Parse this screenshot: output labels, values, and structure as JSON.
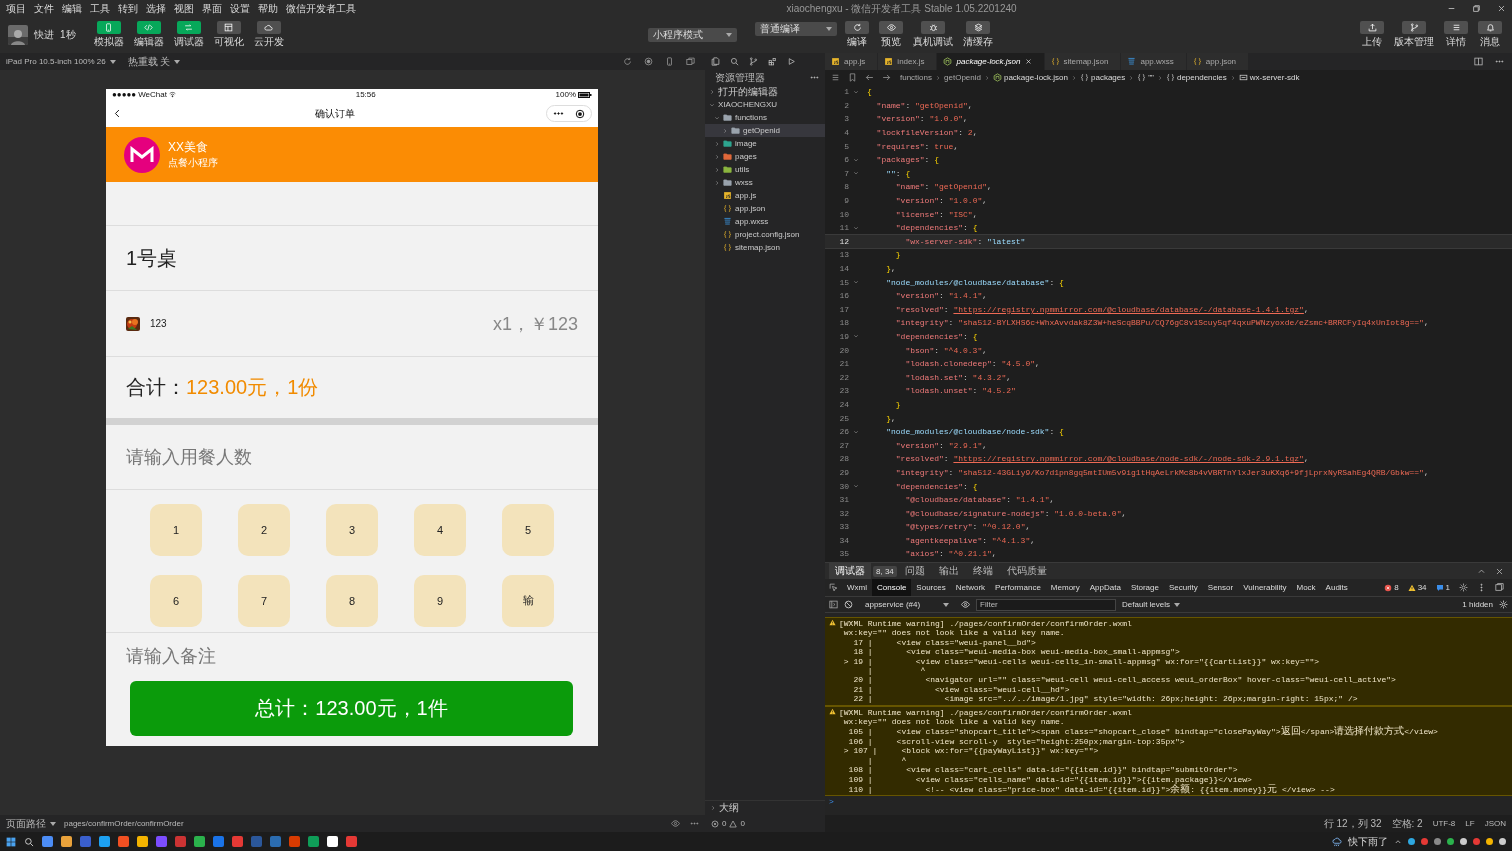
{
  "menu_bar": {
    "items": [
      "项目",
      "文件",
      "编辑",
      "工具",
      "转到",
      "选择",
      "视图",
      "界面",
      "设置",
      "帮助",
      "微信开发者工具"
    ],
    "title": "xiaochengxu - 微信开发者工具 Stable 1.05.2201240"
  },
  "toolbar": {
    "user_name": "快进",
    "timer": "1秒",
    "view_toggles": [
      {
        "label": "模拟器",
        "kind": "phone",
        "on": true
      },
      {
        "label": "编辑器",
        "kind": "code",
        "on": true
      },
      {
        "label": "调试器",
        "kind": "debug",
        "on": true
      },
      {
        "label": "可视化",
        "kind": "layout",
        "on": false
      },
      {
        "label": "云开发",
        "kind": "cloud",
        "on": false
      }
    ],
    "mode_select": "小程序模式",
    "compile_select": "普通编译",
    "actions": [
      {
        "label": "编译",
        "kind": "refresh"
      },
      {
        "label": "预览",
        "kind": "eye"
      },
      {
        "label": "真机调试",
        "kind": "bug"
      },
      {
        "label": "清缓存",
        "kind": "layers"
      }
    ],
    "right_actions": [
      {
        "label": "上传",
        "kind": "upload"
      },
      {
        "label": "版本管理",
        "kind": "branch"
      },
      {
        "label": "详情",
        "kind": "list"
      },
      {
        "label": "消息",
        "kind": "bell"
      }
    ]
  },
  "simulator": {
    "device": "iPad Pro 10.5-inch 100% 26",
    "hot_reload": "热重载 关",
    "page_path_label": "页面路径",
    "page_path": "pages/confirmOrder/confirmOrder",
    "phone": {
      "signal": "●●●●●",
      "carrier": "WeChat",
      "time": "15:56",
      "battery": "100%",
      "nav_title": "确认订单",
      "shop_name": "XX美食",
      "shop_subtitle": "点餐小程序",
      "table": "1号桌",
      "items": [
        {
          "name": "123",
          "qty_price": "x1，￥123"
        }
      ],
      "total_label": "合计：",
      "total_value": "123.00元，1份",
      "people_placeholder": "请输入用餐人数",
      "keypad": [
        "1",
        "2",
        "3",
        "4",
        "5",
        "6",
        "7",
        "8",
        "9",
        "输"
      ],
      "note_placeholder": "请输入备注",
      "submit": "总计：123.00元，1件"
    }
  },
  "explorer": {
    "title": "资源管理器",
    "sections": [
      {
        "label": "打开的编辑器",
        "expanded": false
      },
      {
        "label": "XIAOCHENGXU",
        "expanded": true
      }
    ],
    "tree": [
      {
        "name": "functions",
        "kind": "folder",
        "expanded": true,
        "selected": false,
        "children": [
          {
            "name": "getOpenid",
            "kind": "folder",
            "expanded": false,
            "selected": true
          }
        ]
      },
      {
        "name": "image",
        "kind": "folder-image",
        "expanded": false,
        "selected": false
      },
      {
        "name": "pages",
        "kind": "folder-pages",
        "expanded": false,
        "selected": false
      },
      {
        "name": "utils",
        "kind": "folder-utils",
        "expanded": false,
        "selected": false
      },
      {
        "name": "wxss",
        "kind": "folder",
        "expanded": false,
        "selected": false
      },
      {
        "name": "app.js",
        "kind": "js",
        "selected": false
      },
      {
        "name": "app.json",
        "kind": "json",
        "selected": false
      },
      {
        "name": "app.wxss",
        "kind": "css",
        "selected": false
      },
      {
        "name": "project.config.json",
        "kind": "json",
        "selected": false
      },
      {
        "name": "sitemap.json",
        "kind": "json",
        "selected": false
      }
    ],
    "outline": "大纲",
    "errors": "0",
    "warnings": "0"
  },
  "editor": {
    "tabs": [
      {
        "name": "app.js",
        "kind": "js",
        "selected": false
      },
      {
        "name": "index.js",
        "kind": "js",
        "selected": false
      },
      {
        "name": "package-lock.json",
        "kind": "npm",
        "selected": true
      },
      {
        "name": "sitemap.json",
        "kind": "json",
        "selected": false
      },
      {
        "name": "app.wxss",
        "kind": "css",
        "selected": false
      },
      {
        "name": "app.json",
        "kind": "json",
        "selected": false
      }
    ],
    "breadcrumb": [
      {
        "text": "functions",
        "kind": "plain"
      },
      {
        "text": "getOpenid",
        "kind": "plain"
      },
      {
        "text": "package-lock.json",
        "kind": "npm"
      },
      {
        "text": "packages",
        "kind": "object"
      },
      {
        "text": "\"\"",
        "kind": "object"
      },
      {
        "text": "dependencies",
        "kind": "object"
      },
      {
        "text": "wx-server-sdk",
        "kind": "property"
      }
    ],
    "lines": [
      {
        "num": "1",
        "fold": true,
        "current": false,
        "t": [
          {
            "kind": "brace",
            "text": "{"
          }
        ],
        "children": [
          {
            "num": "2",
            "fold": false,
            "current": false,
            "t": [
              {
                "kind": "key",
                "text": "\"name\""
              },
              {
                "kind": "punct",
                "text": ": "
              },
              {
                "kind": "str",
                "text": "\"getOpenid\""
              },
              {
                "kind": "punct",
                "text": ","
              }
            ]
          },
          {
            "num": "3",
            "fold": false,
            "current": false,
            "t": [
              {
                "kind": "key",
                "text": "\"version\""
              },
              {
                "kind": "punct",
                "text": ": "
              },
              {
                "kind": "str",
                "text": "\"1.0.0\""
              },
              {
                "kind": "punct",
                "text": ","
              }
            ]
          },
          {
            "num": "4",
            "fold": false,
            "current": false,
            "t": [
              {
                "kind": "key",
                "text": "\"lockfileVersion\""
              },
              {
                "kind": "punct",
                "text": ": "
              },
              {
                "kind": "str",
                "text": "2"
              },
              {
                "kind": "punct",
                "text": ","
              }
            ]
          },
          {
            "num": "5",
            "fold": false,
            "current": false,
            "t": [
              {
                "kind": "key",
                "text": "\"requires\""
              },
              {
                "kind": "punct",
                "text": ": "
              },
              {
                "kind": "str",
                "text": "true"
              },
              {
                "kind": "punct",
                "text": ","
              }
            ]
          },
          {
            "num": "6",
            "fold": true,
            "current": false,
            "t": [
              {
                "kind": "key",
                "text": "\"packages\""
              },
              {
                "kind": "punct",
                "text": ": "
              },
              {
                "kind": "brace",
                "text": "{"
              }
            ],
            "children": [
              {
                "num": "7",
                "fold": true,
                "current": false,
                "t": [
                  {
                    "kind": "key2",
                    "text": "\"\""
                  },
                  {
                    "kind": "punct",
                    "text": ": "
                  },
                  {
                    "kind": "brace",
                    "text": "{"
                  }
                ],
                "children": [
                  {
                    "num": "8",
                    "fold": false,
                    "current": false,
                    "t": [
                      {
                        "kind": "key",
                        "text": "\"name\""
                      },
                      {
                        "kind": "punct",
                        "text": ": "
                      },
                      {
                        "kind": "str",
                        "text": "\"getOpenid\""
                      },
                      {
                        "kind": "punct",
                        "text": ","
                      }
                    ]
                  },
                  {
                    "num": "9",
                    "fold": false,
                    "current": false,
                    "t": [
                      {
                        "kind": "key",
                        "text": "\"version\""
                      },
                      {
                        "kind": "punct",
                        "text": ": "
                      },
                      {
                        "kind": "str",
                        "text": "\"1.0.0\""
                      },
                      {
                        "kind": "punct",
                        "text": ","
                      }
                    ]
                  },
                  {
                    "num": "10",
                    "fold": false,
                    "current": false,
                    "t": [
                      {
                        "kind": "key",
                        "text": "\"license\""
                      },
                      {
                        "kind": "punct",
                        "text": ": "
                      },
                      {
                        "kind": "str",
                        "text": "\"ISC\""
                      },
                      {
                        "kind": "punct",
                        "text": ","
                      }
                    ]
                  },
                  {
                    "num": "11",
                    "fold": true,
                    "current": false,
                    "t": [
                      {
                        "kind": "key",
                        "text": "\"dependencies\""
                      },
                      {
                        "kind": "punct",
                        "text": ": "
                      },
                      {
                        "kind": "brace",
                        "text": "{"
                      }
                    ],
                    "children": [
                      {
                        "num": "12",
                        "fold": false,
                        "current": true,
                        "t": [
                          {
                            "kind": "key",
                            "text": "\"wx-server-sdk\""
                          },
                          {
                            "kind": "punct",
                            "text": ": "
                          },
                          {
                            "kind": "val",
                            "text": "\"latest\""
                          }
                        ]
                      }
                    ]
                  },
                  {
                    "num": "13",
                    "fold": false,
                    "current": false,
                    "t": [
                      {
                        "kind": "brace",
                        "text": "}"
                      }
                    ]
                  }
                ]
              },
              {
                "num": "14",
                "fold": false,
                "current": false,
                "t": [
                  {
                    "kind": "brace",
                    "text": "}"
                  },
                  {
                    "kind": "punct",
                    "text": ","
                  }
                ]
              },
              {
                "num": "15",
                "fold": true,
                "current": false,
                "t": [
                  {
                    "kind": "key2",
                    "text": "\"node_modules/@cloudbase/database\""
                  },
                  {
                    "kind": "punct",
                    "text": ": "
                  },
                  {
                    "kind": "brace",
                    "text": "{"
                  }
                ],
                "children": [
                  {
                    "num": "16",
                    "fold": false,
                    "current": false,
                    "t": [
                      {
                        "kind": "key",
                        "text": "\"version\""
                      },
                      {
                        "kind": "punct",
                        "text": ": "
                      },
                      {
                        "kind": "str",
                        "text": "\"1.4.1\""
                      },
                      {
                        "kind": "punct",
                        "text": ","
                      }
                    ]
                  },
                  {
                    "num": "17",
                    "fold": false,
                    "current": false,
                    "t": [
                      {
                        "kind": "key",
                        "text": "\"resolved\""
                      },
                      {
                        "kind": "punct",
                        "text": ": "
                      },
                      {
                        "kind": "url",
                        "text": "\"https://registry.npmmirror.com/@cloudbase/database/-/database-1.4.1.tgz\""
                      },
                      {
                        "kind": "punct",
                        "text": ","
                      }
                    ]
                  },
                  {
                    "num": "18",
                    "fold": false,
                    "current": false,
                    "t": [
                      {
                        "kind": "key",
                        "text": "\"integrity\""
                      },
                      {
                        "kind": "punct",
                        "text": ": "
                      },
                      {
                        "kind": "str",
                        "text": "\"sha512-BYLXHS6c+WhxAvvdak8Z3W+heScqBBPu/CQ76gC8v1Scuy5qf4qxuPWNzyoxde/eZsmc+BRRCFyIq4xUnIot8g==\""
                      },
                      {
                        "kind": "punct",
                        "text": ","
                      }
                    ]
                  },
                  {
                    "num": "19",
                    "fold": true,
                    "current": false,
                    "t": [
                      {
                        "kind": "key",
                        "text": "\"dependencies\""
                      },
                      {
                        "kind": "punct",
                        "text": ": "
                      },
                      {
                        "kind": "brace",
                        "text": "{"
                      }
                    ],
                    "children": [
                      {
                        "num": "20",
                        "fold": false,
                        "current": false,
                        "t": [
                          {
                            "kind": "key",
                            "text": "\"bson\""
                          },
                          {
                            "kind": "punct",
                            "text": ": "
                          },
                          {
                            "kind": "str",
                            "text": "\"^4.0.3\""
                          },
                          {
                            "kind": "punct",
                            "text": ","
                          }
                        ]
                      },
                      {
                        "num": "21",
                        "fold": false,
                        "current": false,
                        "t": [
                          {
                            "kind": "key",
                            "text": "\"lodash.clonedeep\""
                          },
                          {
                            "kind": "punct",
                            "text": ": "
                          },
                          {
                            "kind": "str",
                            "text": "\"4.5.0\""
                          },
                          {
                            "kind": "punct",
                            "text": ","
                          }
                        ]
                      },
                      {
                        "num": "22",
                        "fold": false,
                        "current": false,
                        "t": [
                          {
                            "kind": "key",
                            "text": "\"lodash.set\""
                          },
                          {
                            "kind": "punct",
                            "text": ": "
                          },
                          {
                            "kind": "str",
                            "text": "\"4.3.2\""
                          },
                          {
                            "kind": "punct",
                            "text": ","
                          }
                        ]
                      },
                      {
                        "num": "23",
                        "fold": false,
                        "current": false,
                        "t": [
                          {
                            "kind": "key",
                            "text": "\"lodash.unset\""
                          },
                          {
                            "kind": "punct",
                            "text": ": "
                          },
                          {
                            "kind": "str",
                            "text": "\"4.5.2\""
                          }
                        ]
                      }
                    ]
                  },
                  {
                    "num": "24",
                    "fold": false,
                    "current": false,
                    "t": [
                      {
                        "kind": "brace",
                        "text": "}"
                      }
                    ]
                  }
                ]
              },
              {
                "num": "25",
                "fold": false,
                "current": false,
                "t": [
                  {
                    "kind": "brace",
                    "text": "}"
                  },
                  {
                    "kind": "punct",
                    "text": ","
                  }
                ]
              },
              {
                "num": "26",
                "fold": true,
                "current": false,
                "t": [
                  {
                    "kind": "key2",
                    "text": "\"node_modules/@cloudbase/node-sdk\""
                  },
                  {
                    "kind": "punct",
                    "text": ": "
                  },
                  {
                    "kind": "brace",
                    "text": "{"
                  }
                ],
                "children": [
                  {
                    "num": "27",
                    "fold": false,
                    "current": false,
                    "t": [
                      {
                        "kind": "key",
                        "text": "\"version\""
                      },
                      {
                        "kind": "punct",
                        "text": ": "
                      },
                      {
                        "kind": "str",
                        "text": "\"2.9.1\""
                      },
                      {
                        "kind": "punct",
                        "text": ","
                      }
                    ]
                  },
                  {
                    "num": "28",
                    "fold": false,
                    "current": false,
                    "t": [
                      {
                        "kind": "key",
                        "text": "\"resolved\""
                      },
                      {
                        "kind": "punct",
                        "text": ": "
                      },
                      {
                        "kind": "url",
                        "text": "\"https://registry.npmmirror.com/@cloudbase/node-sdk/-/node-sdk-2.9.1.tgz\""
                      },
                      {
                        "kind": "punct",
                        "text": ","
                      }
                    ]
                  },
                  {
                    "num": "29",
                    "fold": false,
                    "current": false,
                    "t": [
                      {
                        "kind": "key",
                        "text": "\"integrity\""
                      },
                      {
                        "kind": "punct",
                        "text": ": "
                      },
                      {
                        "kind": "str",
                        "text": "\"sha512-43GLiy9/Ko7d1pn8gq5mtIUm5v9ig1tHqAeLrkMc8b4vVBRTnYlxJer3uKXq6+9fjLprxNyRSahEg4QRB/Gbkw==\""
                      },
                      {
                        "kind": "punct",
                        "text": ","
                      }
                    ]
                  },
                  {
                    "num": "30",
                    "fold": true,
                    "current": false,
                    "t": [
                      {
                        "kind": "key",
                        "text": "\"dependencies\""
                      },
                      {
                        "kind": "punct",
                        "text": ": "
                      },
                      {
                        "kind": "brace",
                        "text": "{"
                      }
                    ],
                    "children": [
                      {
                        "num": "31",
                        "fold": false,
                        "current": false,
                        "t": [
                          {
                            "kind": "key",
                            "text": "\"@cloudbase/database\""
                          },
                          {
                            "kind": "punct",
                            "text": ": "
                          },
                          {
                            "kind": "str",
                            "text": "\"1.4.1\""
                          },
                          {
                            "kind": "punct",
                            "text": ","
                          }
                        ]
                      },
                      {
                        "num": "32",
                        "fold": false,
                        "current": false,
                        "t": [
                          {
                            "kind": "key",
                            "text": "\"@cloudbase/signature-nodejs\""
                          },
                          {
                            "kind": "punct",
                            "text": ": "
                          },
                          {
                            "kind": "str",
                            "text": "\"1.0.0-beta.0\""
                          },
                          {
                            "kind": "punct",
                            "text": ","
                          }
                        ]
                      },
                      {
                        "num": "33",
                        "fold": false,
                        "current": false,
                        "t": [
                          {
                            "kind": "key",
                            "text": "\"@types/retry\""
                          },
                          {
                            "kind": "punct",
                            "text": ": "
                          },
                          {
                            "kind": "str",
                            "text": "\"^0.12.0\""
                          },
                          {
                            "kind": "punct",
                            "text": ","
                          }
                        ]
                      },
                      {
                        "num": "34",
                        "fold": false,
                        "current": false,
                        "t": [
                          {
                            "kind": "key",
                            "text": "\"agentkeepalive\""
                          },
                          {
                            "kind": "punct",
                            "text": ": "
                          },
                          {
                            "kind": "str",
                            "text": "\"^4.1.3\""
                          },
                          {
                            "kind": "punct",
                            "text": ","
                          }
                        ]
                      },
                      {
                        "num": "35",
                        "fold": false,
                        "current": false,
                        "t": [
                          {
                            "kind": "key",
                            "text": "\"axios\""
                          },
                          {
                            "kind": "punct",
                            "text": ": "
                          },
                          {
                            "kind": "str",
                            "text": "\"^0.21.1\""
                          },
                          {
                            "kind": "punct",
                            "text": ","
                          }
                        ]
                      }
                    ]
                  }
                ]
              }
            ]
          }
        ]
      }
    ],
    "status": [
      "行 12，列 32",
      "空格: 2",
      "UTF-8",
      "LF",
      "JSON"
    ]
  },
  "devtools": {
    "panel_tabs": [
      {
        "label": "调试器",
        "selected": true,
        "badge": "8, 34"
      },
      {
        "label": "问题",
        "selected": false
      },
      {
        "label": "输出",
        "selected": false
      },
      {
        "label": "终端",
        "selected": false
      },
      {
        "label": "代码质量",
        "selected": false
      }
    ],
    "tool_tabs": [
      {
        "label": "Wxml",
        "selected": false
      },
      {
        "label": "Console",
        "selected": true
      },
      {
        "label": "Sources",
        "selected": false
      },
      {
        "label": "Network",
        "selected": false
      },
      {
        "label": "Performance",
        "selected": false
      },
      {
        "label": "Memory",
        "selected": false
      },
      {
        "label": "AppData",
        "selected": false
      },
      {
        "label": "Storage",
        "selected": false
      },
      {
        "label": "Security",
        "selected": false
      },
      {
        "label": "Sensor",
        "selected": false
      },
      {
        "label": "Vulnerability",
        "selected": false
      },
      {
        "label": "Mock",
        "selected": false
      },
      {
        "label": "Audits",
        "selected": false
      }
    ],
    "errors": "8",
    "warnings": "34",
    "infos": "1",
    "context": "appservice (#4)",
    "filter_placeholder": "Filter",
    "levels": "Default levels",
    "hidden": "1 hidden",
    "messages": [
      {
        "kind": "warning",
        "title": "[WXML Runtime warning] ./pages/confirmOrder/confirmOrder.wxml",
        "lines": [
          " wx:key=\"\" does not look like a valid key name.",
          "   17 |     <view class=\"weui-panel__bd\">",
          "   18 |       <view class=\"weui-media-box weui-media-box_small-appmsg\">",
          " > 19 |         <view class=\"weui-cells weui-cells_in-small-appmsg\" wx:for=\"{{cartList}}\" wx:key=\"\">",
          "      |          ^",
          "   20 |           <navigator url=\"\" class=\"weui-cell weui-cell_access weui_orderBox\" hover-class=\"weui-cell_active\">",
          "   21 |             <view class=\"weui-cell__hd\">",
          "   22 |               <image src=\"../../image/1.jpg\" style=\"width: 26px;height: 26px;margin-right: 15px;\" />"
        ]
      },
      {
        "kind": "warning",
        "title": "[WXML Runtime warning] ./pages/confirmOrder/confirmOrder.wxml",
        "lines": [
          " wx:key=\"\" does not look like a valid key name.",
          "  105 |     <view class=\"shopcart_title\"><span class=\"shopcart_close\" bindtap=\"closePayWay\">返回</span>请选择付款方式</view>",
          "  106 |     <scroll-view scroll-y  style=\"height:250px;margin-top:35px\">",
          " > 107 |     <block wx:for=\"{{payWayList}}\" wx:key=\"\">",
          "      |      ^",
          "  108 |       <view class=\"cart_cells\" data-id=\"{{item.id}}\" bindtap=\"submitOrder\">",
          "  109 |         <view class=\"cells_name\" data-id=\"{{item.id}}\">{{item.package}}</view>",
          "  110 |           <!-- <view class=\"price-box\" data-id=\"{{item.id}}\">余额: {{item.money}}元 </view> -->"
        ]
      }
    ],
    "prompt": ">"
  },
  "taskbar": {
    "weather": "快下雨了"
  }
}
